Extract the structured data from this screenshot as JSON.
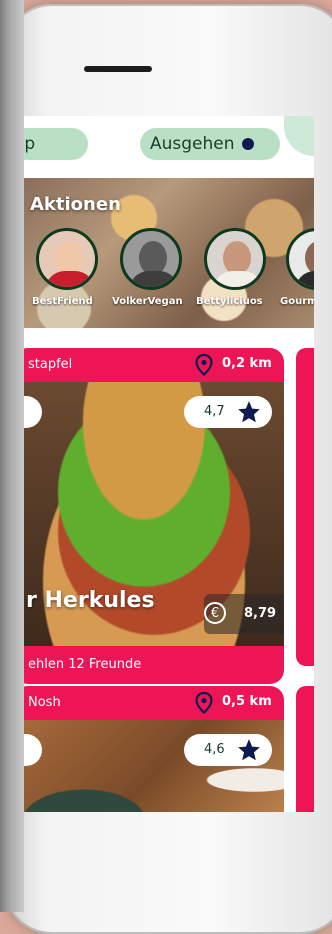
{
  "header": {
    "map_label": "ap",
    "go_out_label": "Ausgehen"
  },
  "promotions": {
    "title": "Aktionen",
    "people": [
      {
        "name": "BestFriend"
      },
      {
        "name": "VolkerVegan"
      },
      {
        "name": "Bettyliciuos"
      },
      {
        "name": "Gourm"
      }
    ]
  },
  "cards": [
    {
      "restaurant": "stapfel",
      "distance": "0,2 km",
      "rating": "4,7",
      "dish": "r Herkules",
      "price": "8,79",
      "footer": "ehlen 12 Freunde"
    },
    {
      "restaurant": "Nosh",
      "distance": "0,5 km",
      "rating": "4,6"
    }
  ],
  "colors": {
    "accent": "#ee1557",
    "pill": "#b9e0c5",
    "navy": "#0e1b4f"
  }
}
